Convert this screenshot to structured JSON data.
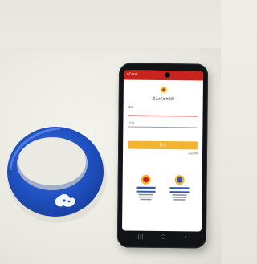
{
  "scene": {
    "objects": [
      "blue silicone RFID wristband",
      "smartphone showing login screen"
    ],
    "colors": {
      "wristband": "#1f4fbf",
      "phone_body": "#111316",
      "app_bar": "#c9231d",
      "login_button": "#f2b531",
      "background": "#ecebe3"
    }
  },
  "phone_screen": {
    "app_bar_title": "eCare",
    "heading": "登入eCare系統",
    "username_label": "帳號",
    "username_placeholder": "",
    "password_placeholder": "密碼",
    "login_button_label": "登入",
    "secondary_link": "忘記密碼",
    "badges": [
      "award-badge-left",
      "award-badge-right"
    ],
    "nav_icons": [
      "recent-apps-icon",
      "home-icon",
      "back-icon"
    ]
  }
}
